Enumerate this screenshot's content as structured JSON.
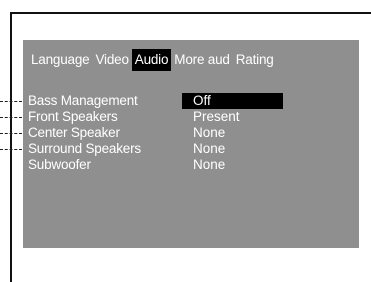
{
  "tabs": [
    {
      "label": "Language",
      "active": false
    },
    {
      "label": "Video",
      "active": false
    },
    {
      "label": "Audio",
      "active": true
    },
    {
      "label": "More aud",
      "active": false
    },
    {
      "label": "Rating",
      "active": false
    }
  ],
  "settings": [
    {
      "label": "Bass Management",
      "value": "Off",
      "selected": true
    },
    {
      "label": "Front Speakers",
      "value": "Present",
      "selected": false
    },
    {
      "label": "Center Speaker",
      "value": "None",
      "selected": false
    },
    {
      "label": "Surround Speakers",
      "value": "None",
      "selected": false
    },
    {
      "label": "Subwoofer",
      "value": "None",
      "selected": false
    }
  ],
  "colors": {
    "screen_background": "#8f8f8f",
    "highlight": "#000000",
    "text": "#ffffff"
  }
}
